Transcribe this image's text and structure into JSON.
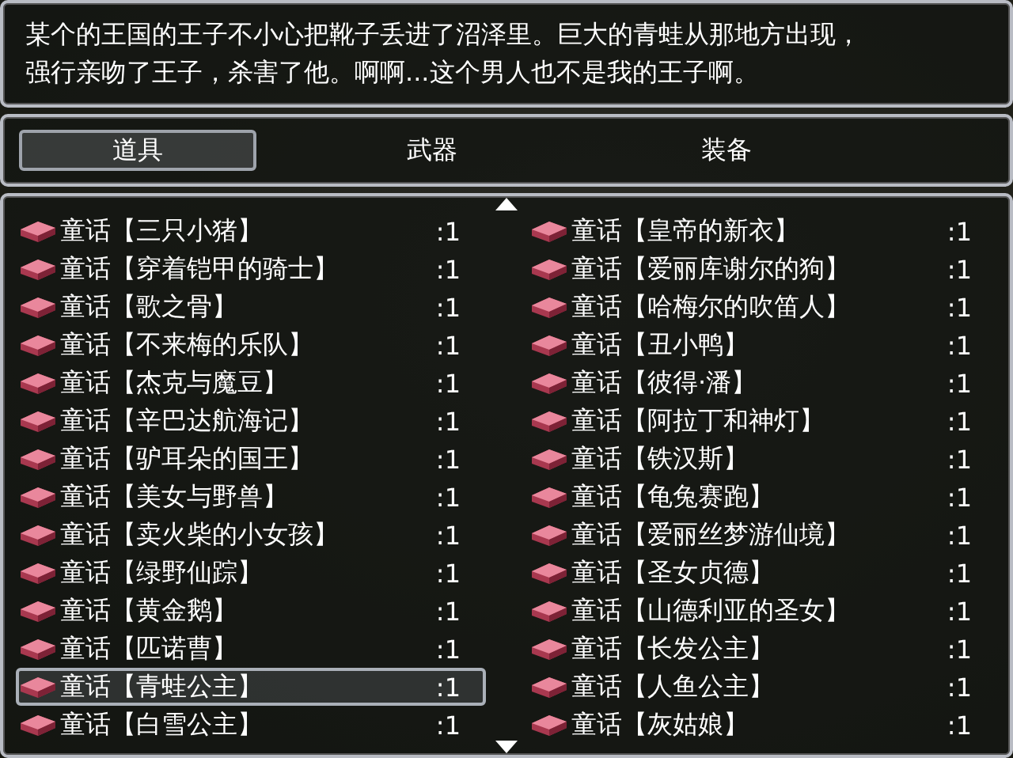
{
  "help": {
    "lines": [
      "某个的王国的王子不小心把靴子丢进了沼泽里。巨大的青蛙从那地方出现，",
      "强行亲吻了王子，杀害了他。啊啊...这个男人也不是我的王子啊。"
    ]
  },
  "tabs": [
    {
      "label": "道具",
      "selected": true
    },
    {
      "label": "武器",
      "selected": false
    },
    {
      "label": "装备",
      "selected": false
    }
  ],
  "items": [
    {
      "name": "童话【三只小猪】",
      "count": ":1",
      "selected": false
    },
    {
      "name": "童话【皇帝的新衣】",
      "count": ":1",
      "selected": false
    },
    {
      "name": "童话【穿着铠甲的骑士】",
      "count": ":1",
      "selected": false
    },
    {
      "name": "童话【爱丽库谢尔的狗】",
      "count": ":1",
      "selected": false
    },
    {
      "name": "童话【歌之骨】",
      "count": ":1",
      "selected": false
    },
    {
      "name": "童话【哈梅尔的吹笛人】",
      "count": ":1",
      "selected": false
    },
    {
      "name": "童话【不来梅的乐队】",
      "count": ":1",
      "selected": false
    },
    {
      "name": "童话【丑小鸭】",
      "count": ":1",
      "selected": false
    },
    {
      "name": "童话【杰克与魔豆】",
      "count": ":1",
      "selected": false
    },
    {
      "name": "童话【彼得·潘】",
      "count": ":1",
      "selected": false
    },
    {
      "name": "童话【辛巴达航海记】",
      "count": ":1",
      "selected": false
    },
    {
      "name": "童话【阿拉丁和神灯】",
      "count": ":1",
      "selected": false
    },
    {
      "name": "童话【驴耳朵的国王】",
      "count": ":1",
      "selected": false
    },
    {
      "name": "童话【铁汉斯】",
      "count": ":1",
      "selected": false
    },
    {
      "name": "童话【美女与野兽】",
      "count": ":1",
      "selected": false
    },
    {
      "name": "童话【龟兔赛跑】",
      "count": ":1",
      "selected": false
    },
    {
      "name": "童话【卖火柴的小女孩】",
      "count": ":1",
      "selected": false
    },
    {
      "name": "童话【爱丽丝梦游仙境】",
      "count": ":1",
      "selected": false
    },
    {
      "name": "童话【绿野仙踪】",
      "count": ":1",
      "selected": false
    },
    {
      "name": "童话【圣女贞德】",
      "count": ":1",
      "selected": false
    },
    {
      "name": "童话【黄金鹅】",
      "count": ":1",
      "selected": false
    },
    {
      "name": "童话【山德利亚的圣女】",
      "count": ":1",
      "selected": false
    },
    {
      "name": "童话【匹诺曹】",
      "count": ":1",
      "selected": false
    },
    {
      "name": "童话【长发公主】",
      "count": ":1",
      "selected": false
    },
    {
      "name": "童话【青蛙公主】",
      "count": ":1",
      "selected": true
    },
    {
      "name": "童话【人鱼公主】",
      "count": ":1",
      "selected": false
    },
    {
      "name": "童话【白雪公主】",
      "count": ":1",
      "selected": false
    },
    {
      "name": "童话【灰姑娘】",
      "count": ":1",
      "selected": false
    }
  ]
}
